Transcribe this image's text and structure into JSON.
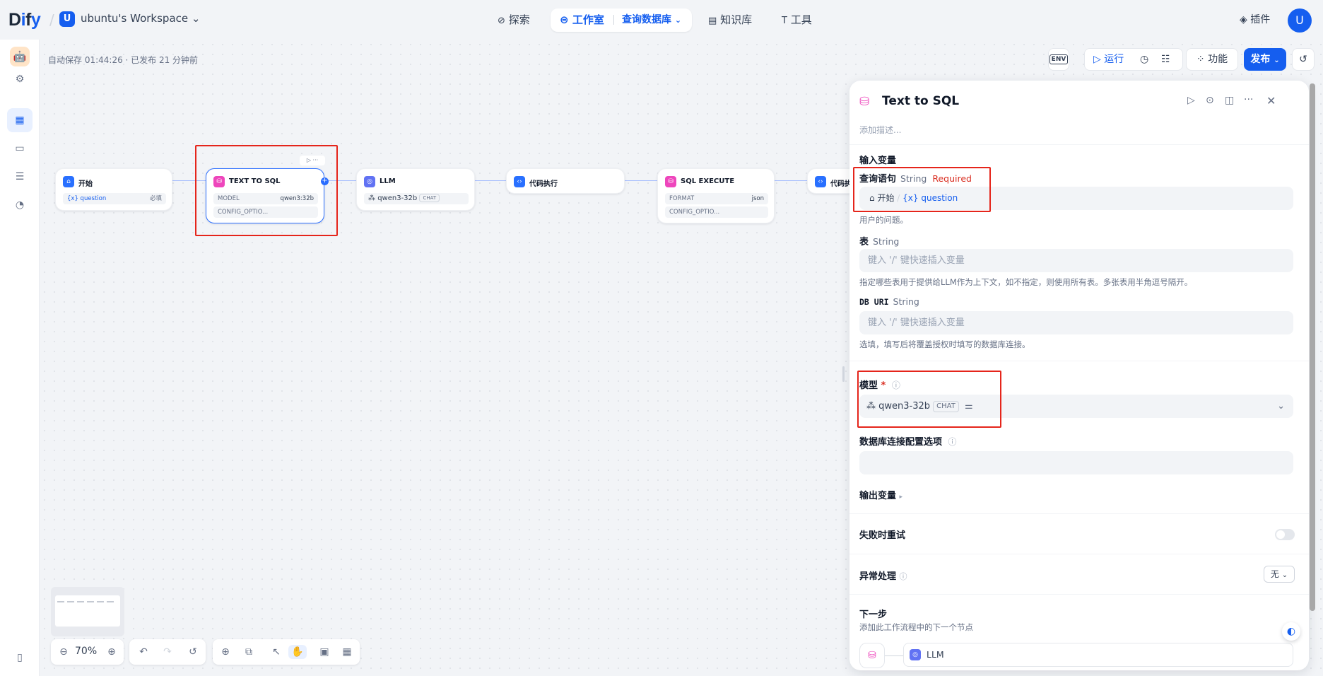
{
  "app": {
    "logo_prefix": "D",
    "logo_accent": "ify",
    "logo_d_mid": "i",
    "logo_f": "f",
    "logo_text": "Dify"
  },
  "workspace": {
    "avatar": "U",
    "name": "ubuntu's Workspace"
  },
  "nav": {
    "explore": "探索",
    "studio": "工作室",
    "app_name": "查询数据库",
    "knowledge": "知识库",
    "tools": "工具"
  },
  "header_right": {
    "plugins": "插件",
    "user_avatar": "U"
  },
  "canvas": {
    "autosave": "自动保存 01:44:26 · 已发布 21 分钟前",
    "toolbar": {
      "env": "ENV",
      "run": "运行",
      "features": "功能",
      "publish": "发布"
    }
  },
  "nodes": {
    "start": {
      "title": "开始",
      "var": "{x} question",
      "var_tag": "必填"
    },
    "text2sql": {
      "title": "TEXT TO SQL",
      "row1_key": "MODEL",
      "row1_val": "qwen3:32b",
      "row2_key": "CONFIG_OPTIO..."
    },
    "llm": {
      "title": "LLM",
      "model": "qwen3-32b",
      "badge": "CHAT"
    },
    "code1": {
      "title": "代码执行"
    },
    "sqlexec": {
      "title": "SQL EXECUTE",
      "row1_key": "FORMAT",
      "row1_val": "json",
      "row2_key": "CONFIG_OPTIO..."
    },
    "code2": {
      "title": "代码执"
    }
  },
  "zoom": {
    "level": "70%"
  },
  "panel": {
    "title": "Text to SQL",
    "description_placeholder": "添加描述...",
    "input_vars_label": "输入变量",
    "query": {
      "label": "查询语句",
      "type": "String",
      "required": "Required",
      "source_node": "开始",
      "source_var": "{x} question",
      "hint": "用户的问题。"
    },
    "table": {
      "label": "表",
      "type": "String",
      "placeholder": "键入 '/' 键快速插入变量",
      "hint": "指定哪些表用于提供给LLM作为上下文，如不指定，则使用所有表。多张表用半角逗号隔开。"
    },
    "db_uri": {
      "label": "DB URI",
      "type": "String",
      "placeholder": "键入 '/' 键快速插入变量",
      "hint": "选填，填写后将覆盖授权时填写的数据库连接。"
    },
    "model": {
      "label": "模型",
      "required_mark": "*",
      "name": "qwen3-32b",
      "badge": "CHAT"
    },
    "db_config_label": "数据库连接配置选项",
    "output_vars_label": "输出变量",
    "retry_label": "失败时重试",
    "error_label": "异常处理",
    "error_value": "无",
    "next_step_label": "下一步",
    "next_step_hint": "添加此工作流程中的下一个节点",
    "next_node": "LLM"
  },
  "colors": {
    "accent": "#155eef",
    "highlight": "#e5251b",
    "pink": "#ee46bc",
    "purple": "#6172f3"
  }
}
